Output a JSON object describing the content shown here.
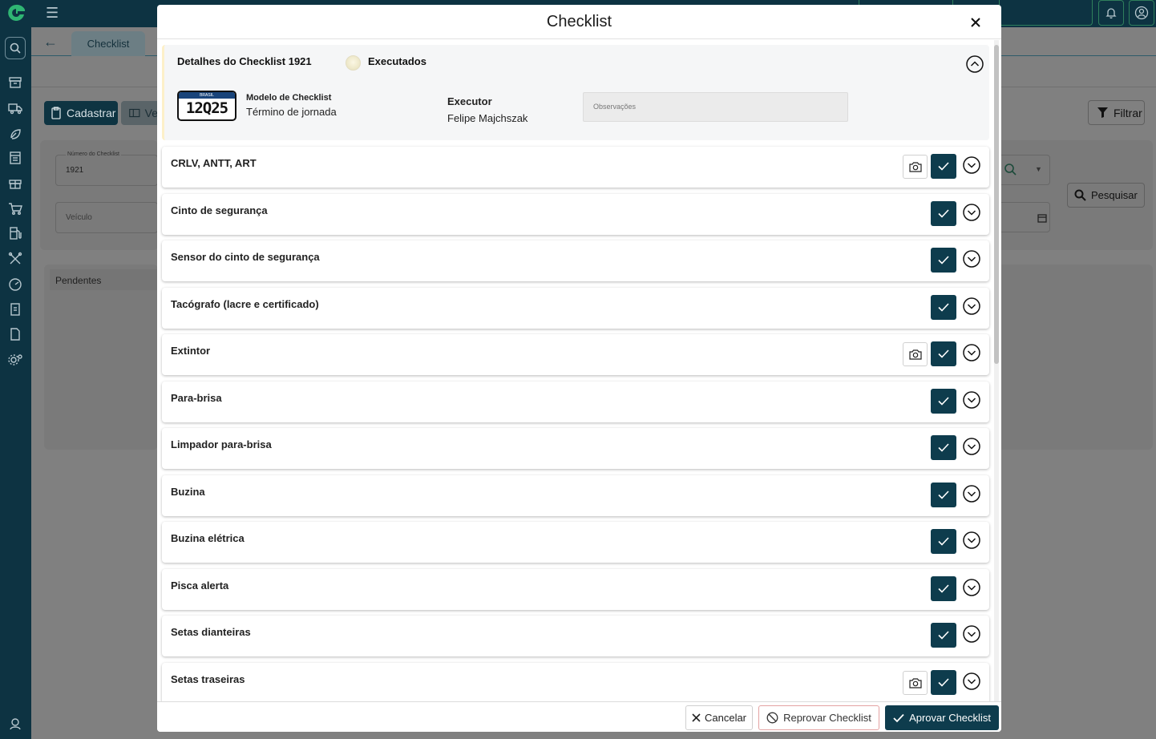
{
  "app": {
    "tab_label": "Checklist",
    "cadastrar_label": "Cadastrar",
    "ver_label": "Ve",
    "filtrar_label": "Filtrar",
    "pesquisar_label": "Pesquisar",
    "numero_label": "Número do Checklist",
    "numero_value": "1921",
    "veiculo_placeholder": "Veículo",
    "pendentes_label": "Pendentes"
  },
  "modal": {
    "title": "Checklist",
    "details": {
      "title": "Detalhes do Checklist 1921",
      "status_label": "Executados",
      "plate_country": "BRASIL",
      "plate_number": "12Q25",
      "model_label": "Modelo de Checklist",
      "model_value": "Término de jornada",
      "executor_label": "Executor",
      "executor_value": "Felipe Majchszak",
      "observacoes_placeholder": "Observações"
    },
    "items": [
      {
        "label": "CRLV, ANTT, ART",
        "has_camera": true
      },
      {
        "label": "Cinto de segurança",
        "has_camera": false
      },
      {
        "label": "Sensor do cinto de segurança",
        "has_camera": false
      },
      {
        "label": "Tacógrafo (lacre e certificado)",
        "has_camera": false
      },
      {
        "label": "Extintor",
        "has_camera": true
      },
      {
        "label": "Para-brisa",
        "has_camera": false
      },
      {
        "label": "Limpador para-brisa",
        "has_camera": false
      },
      {
        "label": "Buzina",
        "has_camera": false
      },
      {
        "label": "Buzina elétrica",
        "has_camera": false
      },
      {
        "label": "Pisca alerta",
        "has_camera": false
      },
      {
        "label": "Setas dianteiras",
        "has_camera": false
      },
      {
        "label": "Setas traseiras",
        "has_camera": true
      }
    ],
    "footer": {
      "cancel_label": "Cancelar",
      "reject_label": "Reprovar Checklist",
      "approve_label": "Aprovar Checklist"
    }
  },
  "icons": {
    "camera": "camera-icon",
    "check": "check-icon",
    "expand": "chevron-down-circle-icon",
    "collapse": "chevron-up-circle-icon",
    "close": "close-icon"
  },
  "colors": {
    "primary": "#0e3c4d",
    "sidebar": "#0d3342",
    "reject_border": "#e4a3a3"
  }
}
